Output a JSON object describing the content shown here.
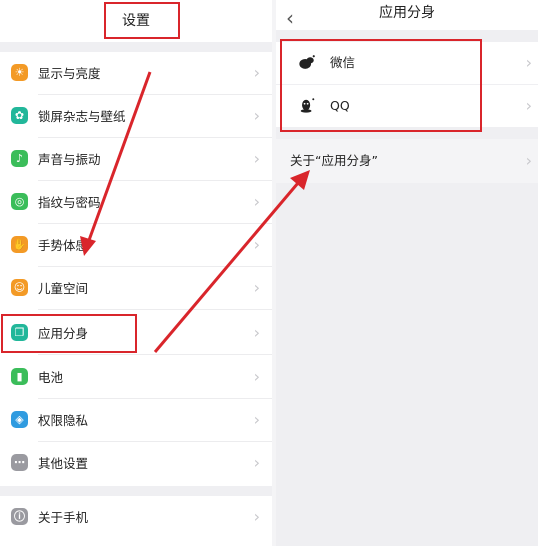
{
  "left": {
    "title": "设置",
    "items": [
      {
        "label": "显示与亮度",
        "icon": "brightness-icon",
        "color": "#f39a26",
        "glyph": "☀"
      },
      {
        "label": "锁屏杂志与壁纸",
        "icon": "wallpaper-icon",
        "color": "#22b79a",
        "glyph": "✿"
      },
      {
        "label": "声音与振动",
        "icon": "sound-icon",
        "color": "#3bbd5a",
        "glyph": "♪"
      },
      {
        "label": "指纹与密码",
        "icon": "fingerprint-icon",
        "color": "#3bbd5a",
        "glyph": "◎"
      },
      {
        "label": "手势体感",
        "icon": "gesture-icon",
        "color": "#f39a26",
        "glyph": "✋"
      },
      {
        "label": "儿童空间",
        "icon": "child-icon",
        "color": "#f39a26",
        "glyph": "☺"
      },
      {
        "label": "应用分身",
        "icon": "app-clone-icon",
        "color": "#22b79a",
        "glyph": "❐"
      },
      {
        "label": "电池",
        "icon": "battery-icon",
        "color": "#3bbd5a",
        "glyph": "▮"
      },
      {
        "label": "权限隐私",
        "icon": "shield-icon",
        "color": "#2f9be0",
        "glyph": "◈"
      },
      {
        "label": "其他设置",
        "icon": "more-icon",
        "color": "#9a9aa0",
        "glyph": "⋯"
      }
    ],
    "about": {
      "label": "关于手机",
      "icon": "info-icon",
      "color": "#9a9aa0",
      "glyph": "ⓘ"
    }
  },
  "right": {
    "title": "应用分身",
    "back_icon": "chevron-left-icon",
    "apps": [
      {
        "label": "微信",
        "icon": "wechat-icon"
      },
      {
        "label": "QQ",
        "icon": "qq-icon"
      }
    ],
    "about_label": "关于“应用分身”"
  },
  "chevron_glyph": "›",
  "back_glyph": "‹",
  "highlight_color": "#d9252b"
}
